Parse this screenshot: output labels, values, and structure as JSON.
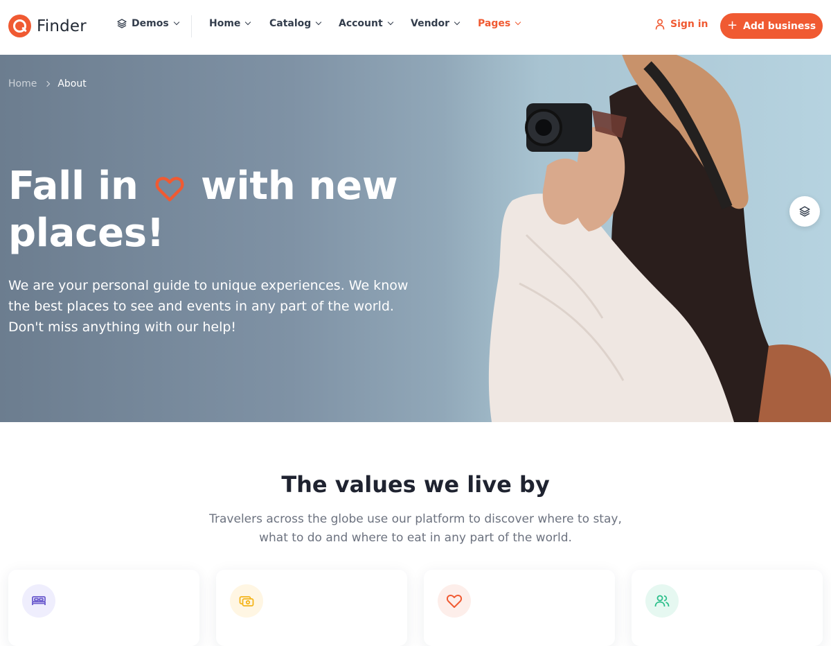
{
  "brand": {
    "name": "Finder",
    "color": "#f05a32"
  },
  "nav": {
    "demos_label": "Demos",
    "items": [
      {
        "label": "Home"
      },
      {
        "label": "Catalog"
      },
      {
        "label": "Account"
      },
      {
        "label": "Vendor"
      },
      {
        "label": "Pages",
        "active": true
      }
    ],
    "signin_label": "Sign in",
    "add_business_label": "Add business"
  },
  "breadcrumb": {
    "home": "Home",
    "current": "About"
  },
  "hero": {
    "title_part1": "Fall in",
    "title_part2": "with new places!",
    "description": "We are your personal guide to unique experiences. We know the best places to see and events in any part of the world. Don't miss anything with our help!"
  },
  "values": {
    "title": "The values we live by",
    "subtitle": "Travelers across the globe use our platform to discover where to stay, what to do and where to eat in any part of the world.",
    "cards": [
      {
        "icon": "bed-icon",
        "color": "#6a5acd",
        "bg": "#efeefd"
      },
      {
        "icon": "money-icon",
        "color": "#f4b41a",
        "bg": "#fff6e3"
      },
      {
        "icon": "heart-icon",
        "color": "#f05a32",
        "bg": "#fdeeea"
      },
      {
        "icon": "users-icon",
        "color": "#2bbf8a",
        "bg": "#e6f8f1"
      }
    ]
  }
}
